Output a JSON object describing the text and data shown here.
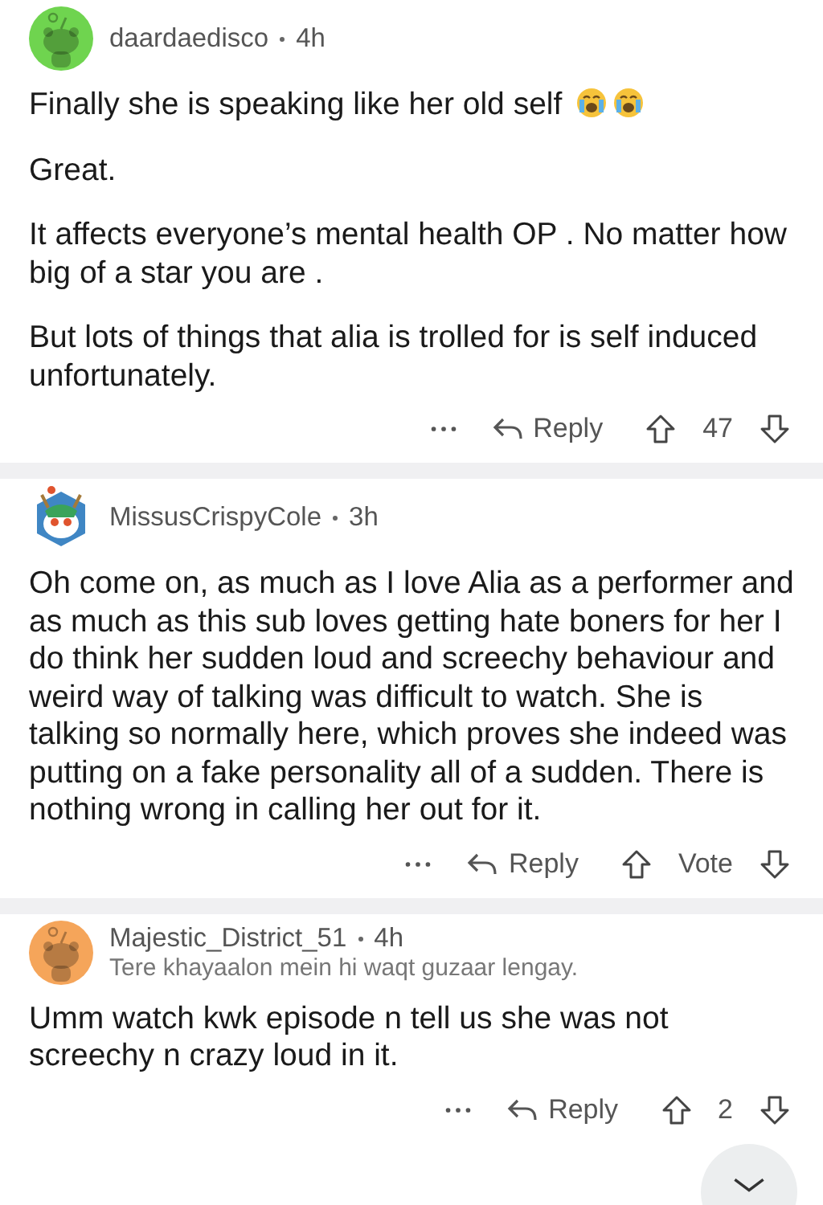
{
  "comments": [
    {
      "author": "daardaedisco",
      "time": "4h",
      "avatar": {
        "kind": "snoo",
        "color": "#6fd44f"
      },
      "paragraphs": [
        {
          "text": "Finally she is speaking like her old self",
          "emojis": [
            {
              "kind": "crying"
            },
            {
              "kind": "crying"
            }
          ]
        },
        {
          "text": "Great."
        },
        {
          "text": "It affects everyone’s mental health OP . No matter how big of a star you are ."
        },
        {
          "text": "But lots of things that alia is trolled for is self induced unfortunately."
        }
      ],
      "reply": "Reply",
      "score": "47"
    },
    {
      "author": "MissusCrispyCole",
      "time": "3h",
      "avatar": {
        "kind": "mascot",
        "color": "#3f86c4"
      },
      "paragraphs": [
        {
          "text": "Oh come on, as much as I love Alia as a performer and as much as this sub loves getting hate boners for her I do think her sudden loud and screechy behaviour and weird way of talking was difficult to watch. She is talking so normally here, which proves she indeed was putting on a fake personality all of a sudden. There is nothing wrong in calling her out for it."
        }
      ],
      "reply": "Reply",
      "score": "Vote"
    },
    {
      "author": "Majestic_District_51",
      "time": "4h",
      "flair": "Tere khayaalon mein hi waqt guzaar lengay.",
      "avatar": {
        "kind": "snoo",
        "color": "#f5a55a"
      },
      "paragraphs": [
        {
          "text": "Umm watch kwk episode n tell us she was not screechy n crazy loud in it."
        }
      ],
      "reply": "Reply",
      "score": "2"
    }
  ]
}
